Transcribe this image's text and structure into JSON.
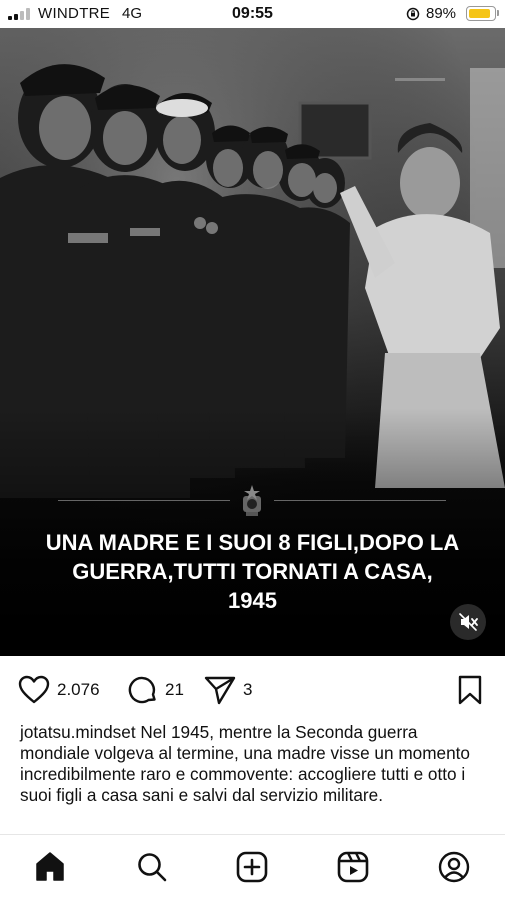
{
  "status_bar": {
    "carrier": "WINDTRE",
    "network": "4G",
    "time": "09:55",
    "battery_percent": "89%",
    "battery_level": 0.89,
    "battery_color": "#f5c518",
    "signal_bars": 2,
    "icons": [
      "signal-icon",
      "orientation-lock-icon",
      "battery-icon"
    ]
  },
  "post": {
    "overlay_text": "UNA MADRE E I SUOI 8 FIGLI,DOPO LA GUERRA,TUTTI TORNATI A CASA, 1945",
    "overlay_lines": [
      "UNA MADRE E I SUOI 8 FIGLI,DOPO LA",
      "GUERRA,TUTTI TORNATI A CASA,",
      "1945"
    ],
    "media_icons": [
      "emblem-icon",
      "muted-speaker-icon"
    ],
    "likes": "2.076",
    "comments": "21",
    "shares": "3",
    "username": "jotatsu.mindset",
    "caption": "Nel 1945, mentre la Seconda guerra mondiale volgeva al termine, una madre visse un momento incredibilmente raro e commovente: accogliere tutti e otto i suoi figli a casa sani e salvi dal servizio militare."
  },
  "action_icons": [
    "heart-icon",
    "comment-icon",
    "send-icon",
    "bookmark-icon"
  ],
  "bottom_nav": {
    "items": [
      "home-icon",
      "search-icon",
      "create-icon",
      "reels-icon",
      "profile-icon"
    ],
    "active": "home-icon"
  }
}
